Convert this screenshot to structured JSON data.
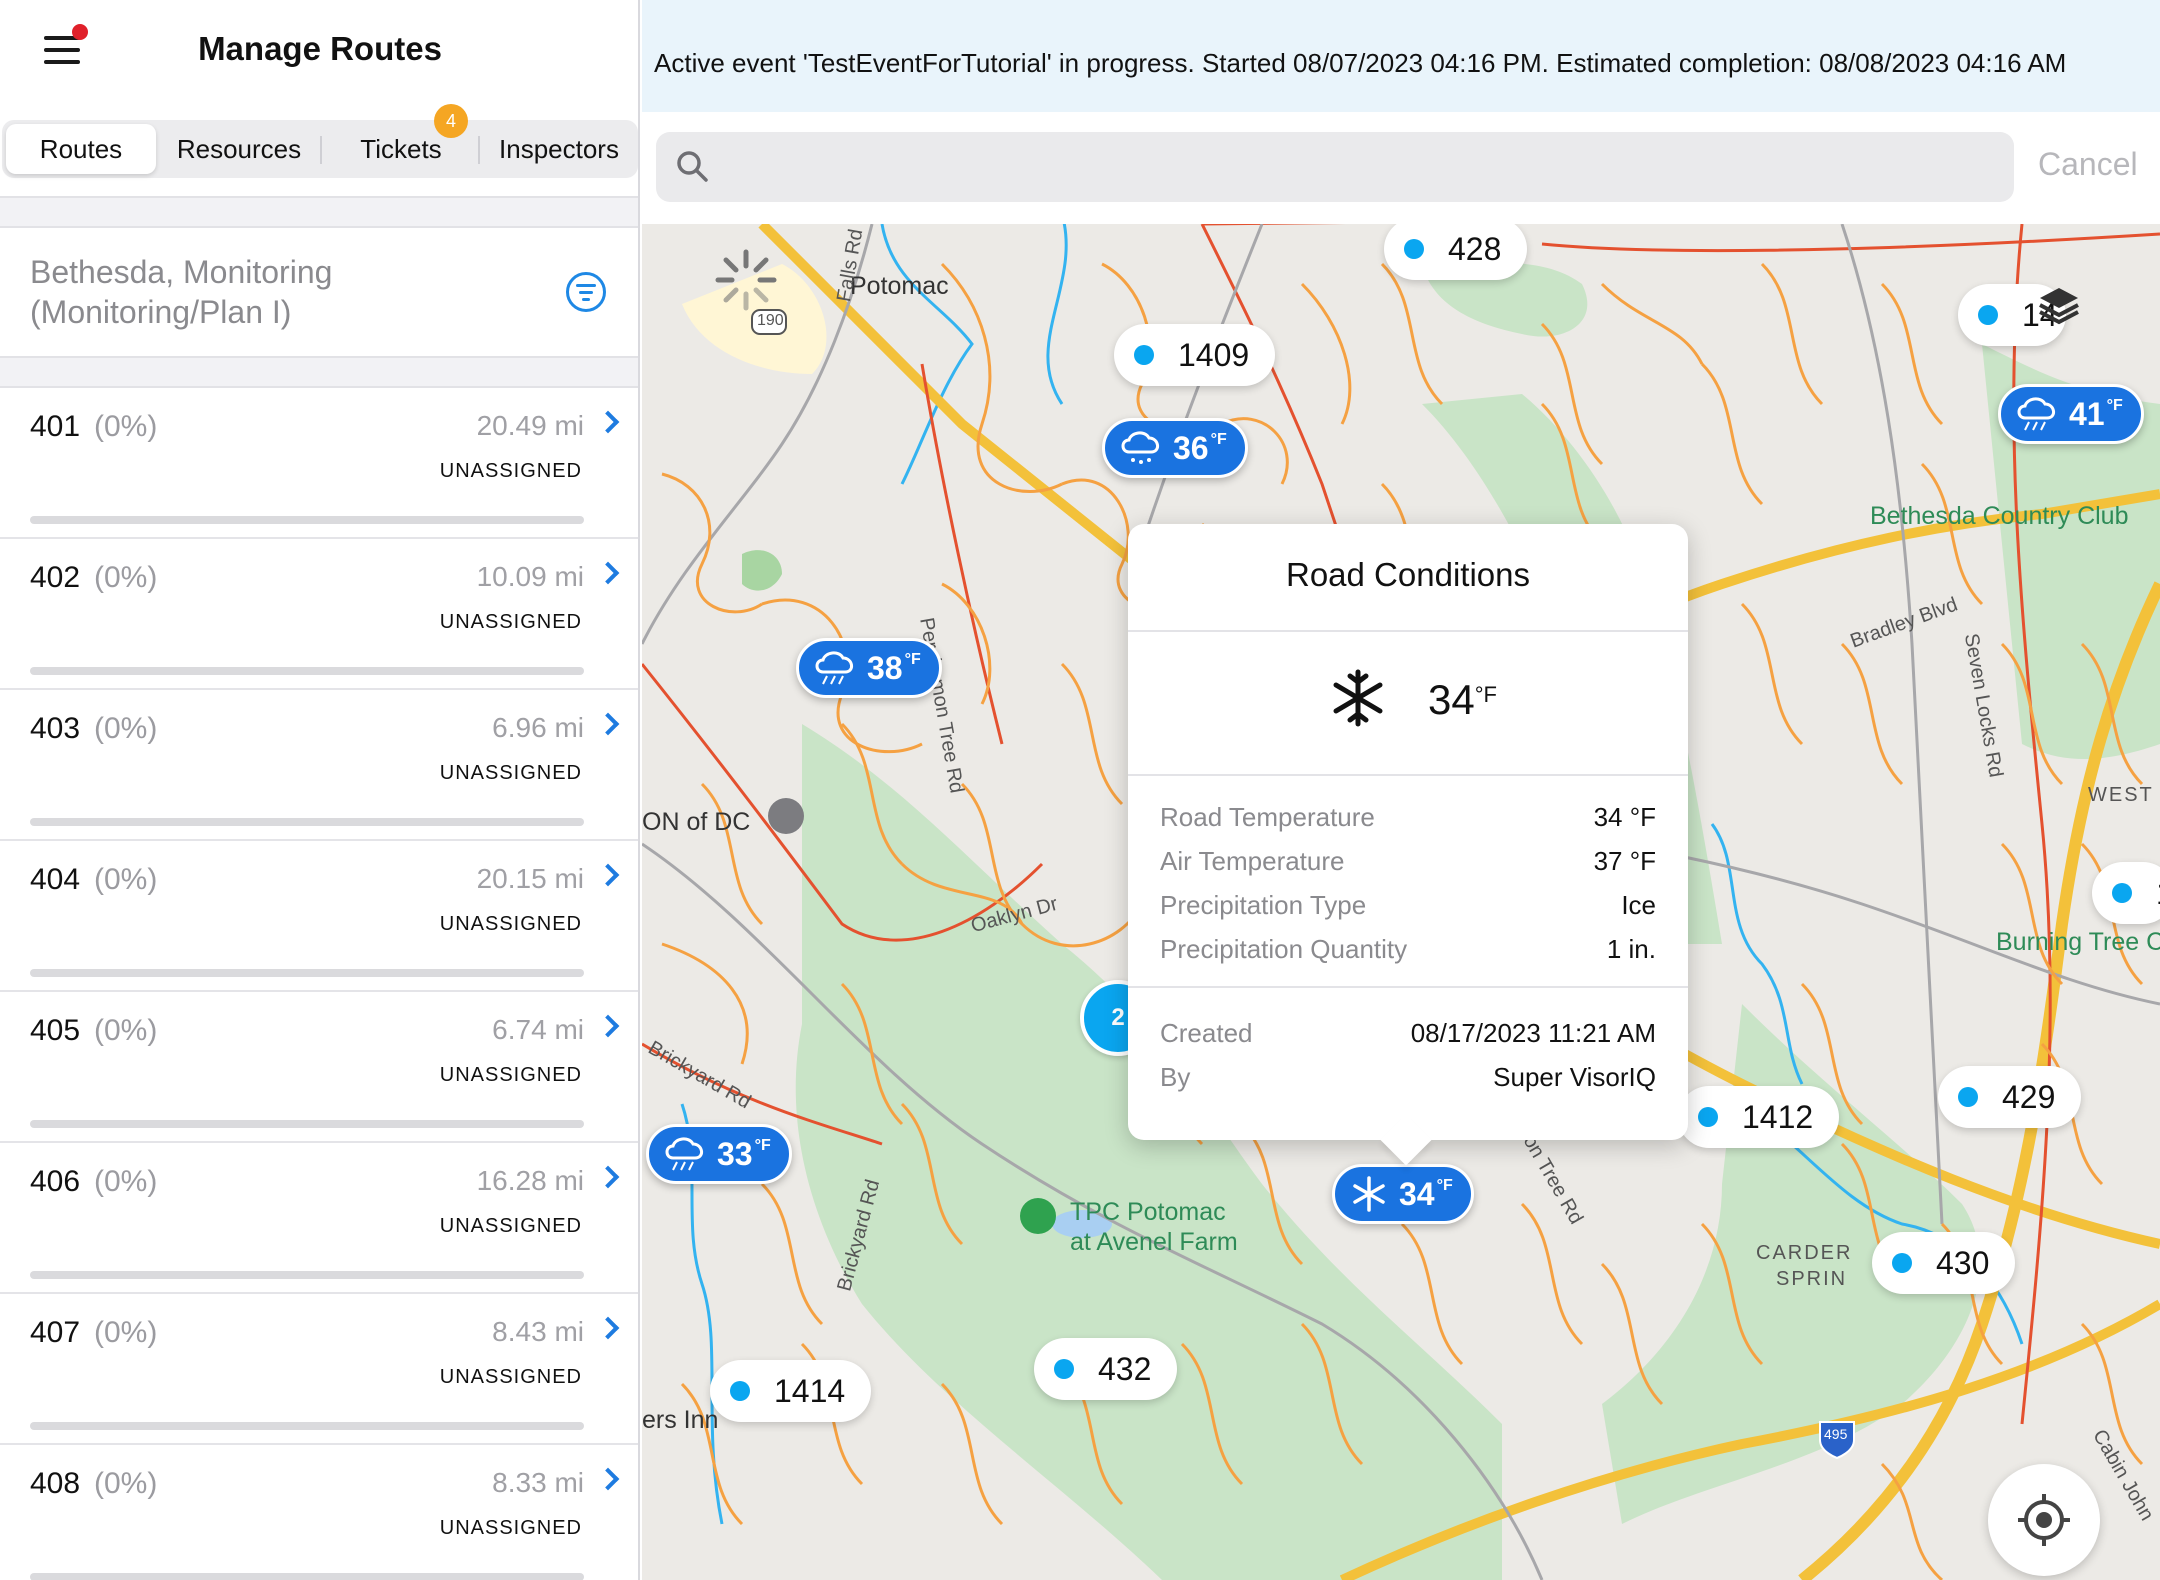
{
  "header": {
    "title": "Manage Routes"
  },
  "tabs": [
    {
      "label": "Routes",
      "active": true
    },
    {
      "label": "Resources",
      "active": false
    },
    {
      "label": "Tickets",
      "active": false,
      "badge": "4"
    },
    {
      "label": "Inspectors",
      "active": false
    }
  ],
  "plan": {
    "text": "Bethesda, Monitoring (Monitoring/Plan I)"
  },
  "routes": [
    {
      "number": "401",
      "percent": "(0%)",
      "distance": "20.49 mi",
      "status": "UNASSIGNED",
      "progress": 0
    },
    {
      "number": "402",
      "percent": "(0%)",
      "distance": "10.09 mi",
      "status": "UNASSIGNED",
      "progress": 0
    },
    {
      "number": "403",
      "percent": "(0%)",
      "distance": "6.96 mi",
      "status": "UNASSIGNED",
      "progress": 0
    },
    {
      "number": "404",
      "percent": "(0%)",
      "distance": "20.15 mi",
      "status": "UNASSIGNED",
      "progress": 0
    },
    {
      "number": "405",
      "percent": "(0%)",
      "distance": "6.74 mi",
      "status": "UNASSIGNED",
      "progress": 0
    },
    {
      "number": "406",
      "percent": "(0%)",
      "distance": "16.28 mi",
      "status": "UNASSIGNED",
      "progress": 0
    },
    {
      "number": "407",
      "percent": "(0%)",
      "distance": "8.43 mi",
      "status": "UNASSIGNED",
      "progress": 0
    },
    {
      "number": "408",
      "percent": "(0%)",
      "distance": "8.33 mi",
      "status": "UNASSIGNED",
      "progress": 0
    }
  ],
  "banner": {
    "text": "Active event 'TestEventForTutorial' in progress. Started 08/07/2023 04:16 PM. Estimated completion: 08/08/2023 04:16 AM"
  },
  "search": {
    "placeholder": "",
    "value": "",
    "cancel_label": "Cancel"
  },
  "map": {
    "labels": {
      "potomac": "Potomac",
      "falls_rd": "Falls Rd",
      "route_190": "190",
      "persimmon_tree_rd": "Persimmon Tree Rd",
      "on_of_dc": "ON of DC",
      "oaklyn_dr": "Oaklyn Dr",
      "brickyard_rd_1": "Brickyard Rd",
      "brickyard_rd_2": "Brickyard Rd",
      "tpc_line1": "TPC Potomac",
      "tpc_line2": "at Avenel Farm",
      "bethesda_cc": "Bethesda Country Club",
      "bradley_blvd": "Bradley Blvd",
      "seven_locks_rd": "Seven Locks Rd",
      "west": "WEST",
      "burning_tree": "Burning Tree C",
      "carderock_1": "CARDER",
      "carderock_2": "SPRIN",
      "interstate_495": "495",
      "ers_inn": "ers Inn",
      "persimmon_tree_rd_2": "mmon Tree Rd",
      "cabin_john": "Cabin John"
    },
    "pins": [
      {
        "label": "428"
      },
      {
        "label": "1409"
      },
      {
        "label": "14"
      },
      {
        "label": "1412"
      },
      {
        "label": "429"
      },
      {
        "label": "430"
      },
      {
        "label": "432"
      },
      {
        "label": "1414"
      },
      {
        "label": "1"
      }
    ],
    "cluster": "2",
    "weather": [
      {
        "temp": "36",
        "unit": "°F",
        "icon": "snow-cloud-icon"
      },
      {
        "temp": "41",
        "unit": "°F",
        "icon": "rain-cloud-icon"
      },
      {
        "temp": "38",
        "unit": "°F",
        "icon": "rain-cloud-icon"
      },
      {
        "temp": "33",
        "unit": "°F",
        "icon": "rain-cloud-icon"
      },
      {
        "temp": "34",
        "unit": "°F",
        "icon": "snowflake-icon"
      }
    ]
  },
  "road_conditions": {
    "title": "Road Conditions",
    "temp": "34",
    "unit": "°F",
    "icon": "snowflake-icon",
    "rows": [
      {
        "key": "Road Temperature",
        "value": "34 °F"
      },
      {
        "key": "Air Temperature",
        "value": "37 °F"
      },
      {
        "key": "Precipitation Type",
        "value": "Ice"
      },
      {
        "key": "Precipitation Quantity",
        "value": "1 in."
      }
    ],
    "meta": [
      {
        "key": "Created",
        "value": "08/17/2023 11:21 AM"
      },
      {
        "key": "By",
        "value": "Super VisorIQ"
      }
    ]
  },
  "colors": {
    "accent": "#1e7be0",
    "pin_dot": "#0aa6f0",
    "weather_badge": "#1a73e0",
    "badge": "#f5a623",
    "notification": "#e0202a"
  }
}
